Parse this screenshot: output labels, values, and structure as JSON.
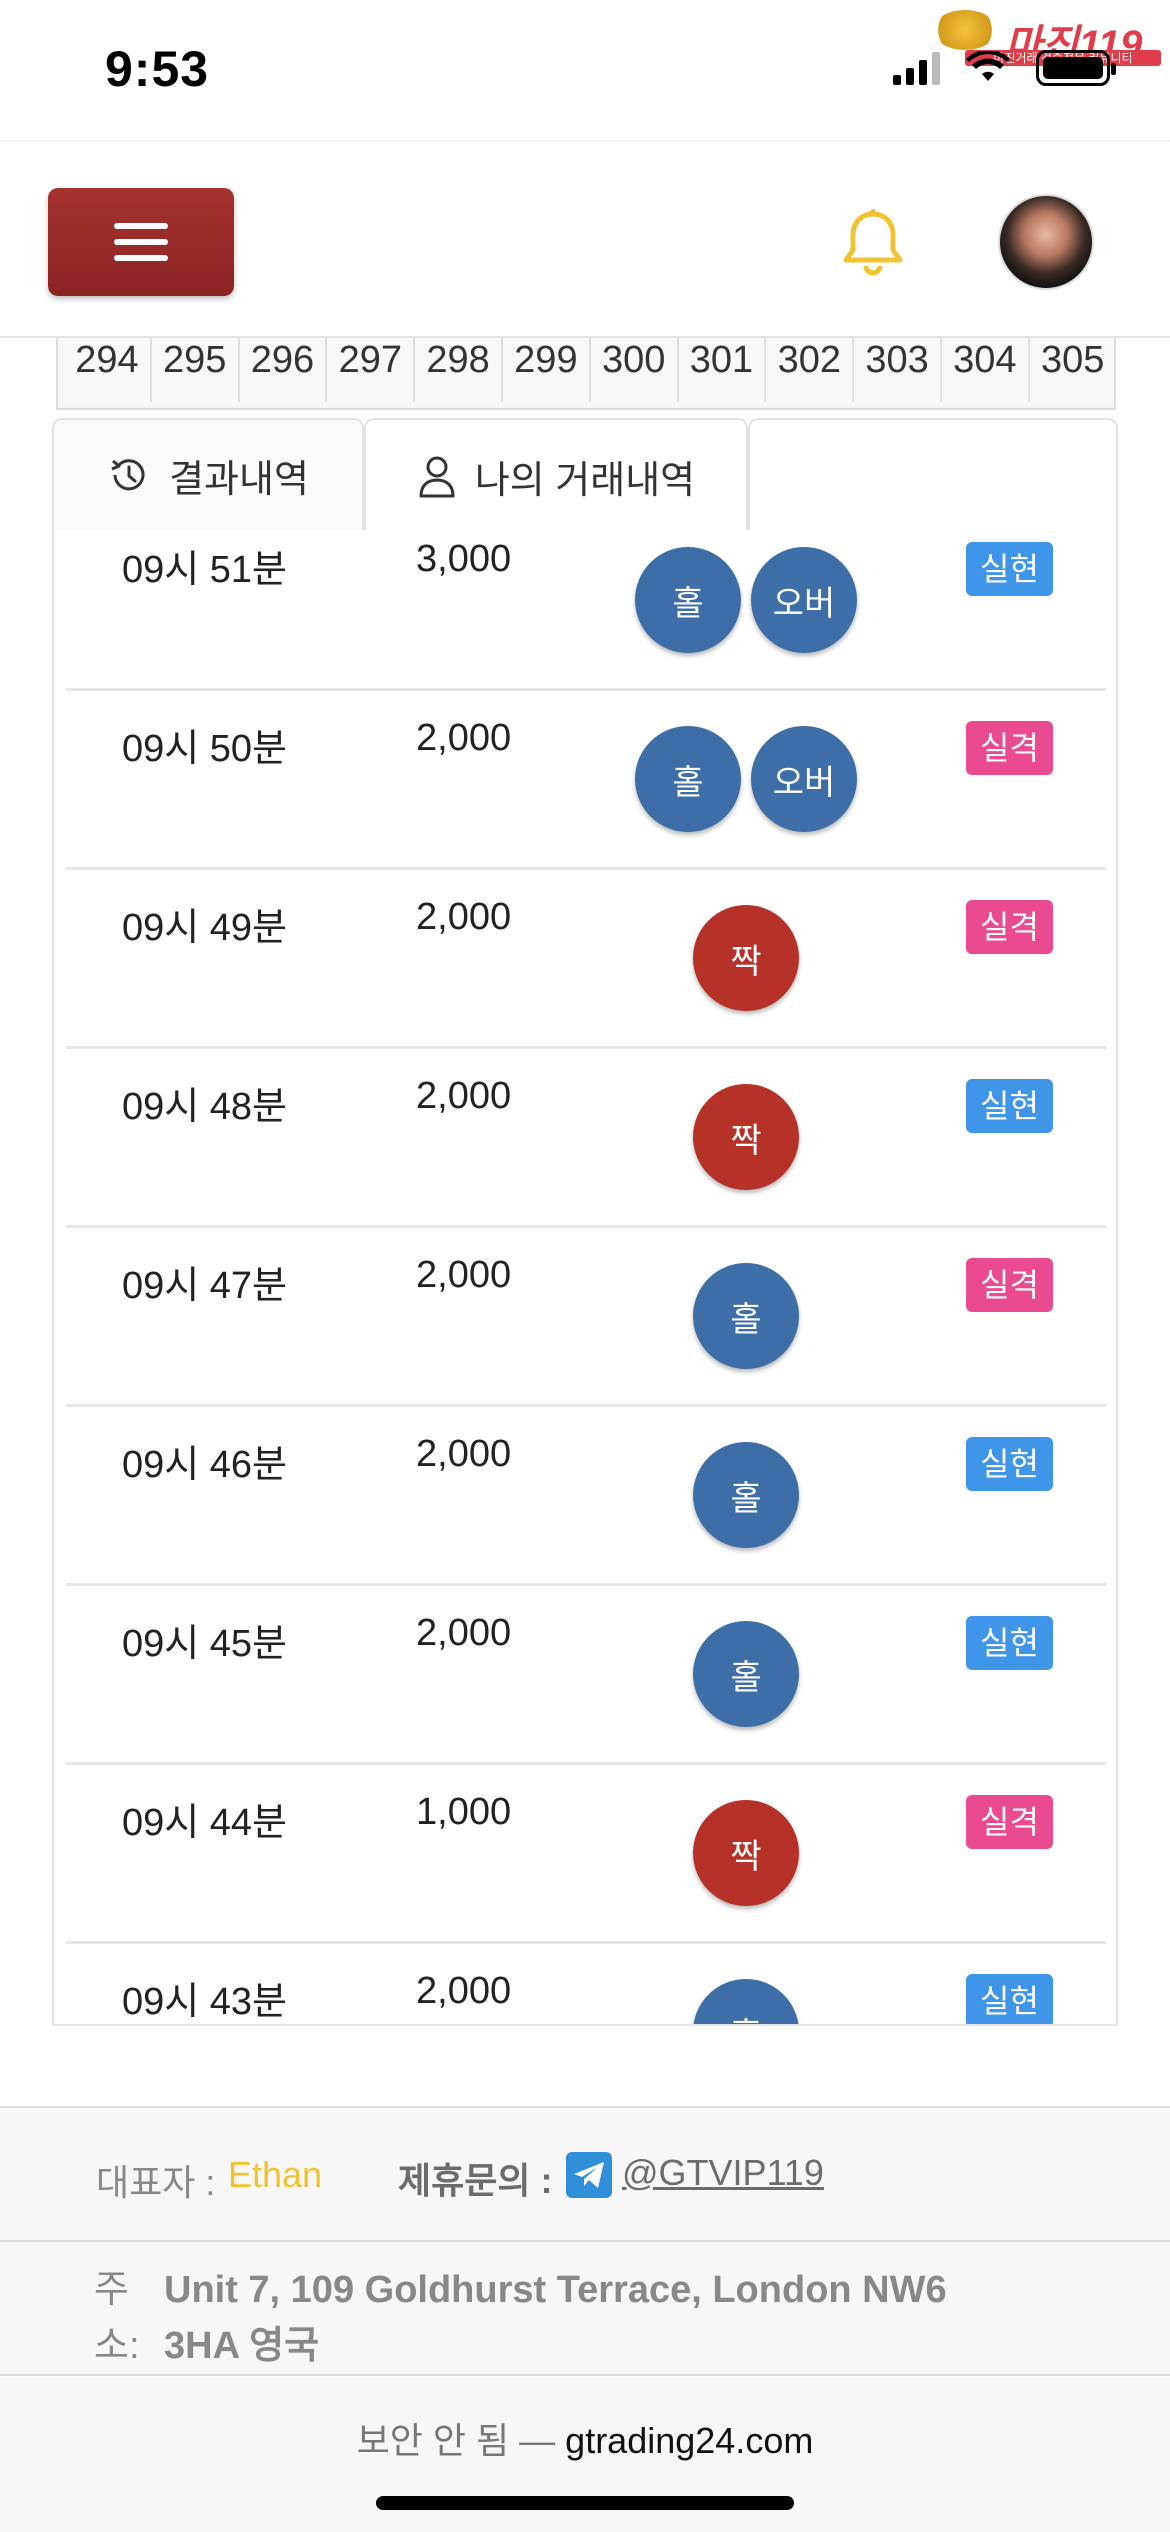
{
  "status_bar": {
    "time": "9:53"
  },
  "watermark": {
    "logo_text": "마진119",
    "sub_text": "마진거래 검증전문 커뮤니티"
  },
  "header": {
    "menu_icon": "hamburger-icon",
    "bell_icon": "bell-icon",
    "bell_color": "#f1c232",
    "menu_color": "#9b2a28"
  },
  "number_strip": [
    "294",
    "295",
    "296",
    "297",
    "298",
    "299",
    "300",
    "301",
    "302",
    "303",
    "304",
    "305"
  ],
  "tabs": [
    {
      "label": "결과내역",
      "icon": "history-icon"
    },
    {
      "label": "나의 거래내역",
      "icon": "user-icon"
    }
  ],
  "trades": [
    {
      "time": "09시 51분",
      "amount": "3,000",
      "picks": [
        {
          "label": "홀",
          "kind": "odd"
        },
        {
          "label": "오버",
          "kind": "over"
        }
      ],
      "result": "실현",
      "result_kind": "win"
    },
    {
      "time": "09시 50분",
      "amount": "2,000",
      "picks": [
        {
          "label": "홀",
          "kind": "odd"
        },
        {
          "label": "오버",
          "kind": "over"
        }
      ],
      "result": "실격",
      "result_kind": "lose"
    },
    {
      "time": "09시 49분",
      "amount": "2,000",
      "picks": [
        {
          "label": "짝",
          "kind": "even"
        }
      ],
      "result": "실격",
      "result_kind": "lose"
    },
    {
      "time": "09시 48분",
      "amount": "2,000",
      "picks": [
        {
          "label": "짝",
          "kind": "even"
        }
      ],
      "result": "실현",
      "result_kind": "win"
    },
    {
      "time": "09시 47분",
      "amount": "2,000",
      "picks": [
        {
          "label": "홀",
          "kind": "odd"
        }
      ],
      "result": "실격",
      "result_kind": "lose"
    },
    {
      "time": "09시 46분",
      "amount": "2,000",
      "picks": [
        {
          "label": "홀",
          "kind": "odd"
        }
      ],
      "result": "실현",
      "result_kind": "win"
    },
    {
      "time": "09시 45분",
      "amount": "2,000",
      "picks": [
        {
          "label": "홀",
          "kind": "odd"
        }
      ],
      "result": "실현",
      "result_kind": "win"
    },
    {
      "time": "09시 44분",
      "amount": "1,000",
      "picks": [
        {
          "label": "짝",
          "kind": "even"
        }
      ],
      "result": "실격",
      "result_kind": "lose"
    },
    {
      "time": "09시 43분",
      "amount": "2,000",
      "picks": [
        {
          "label": "홀",
          "kind": "odd"
        }
      ],
      "result": "실현",
      "result_kind": "win"
    }
  ],
  "footer": {
    "rep_label": "대표자 :",
    "rep_name": "Ethan",
    "inquiry_label": "제휴문의 :",
    "telegram_icon": "telegram-icon",
    "telegram_handle": "@GTVIP119",
    "address_label": "주소:",
    "address": "Unit 7, 109 Goldhurst Terrace, London NW6 3HA 영국"
  },
  "browser": {
    "insecure": "보안 안 됨 —",
    "domain": "gtrading24.com"
  }
}
